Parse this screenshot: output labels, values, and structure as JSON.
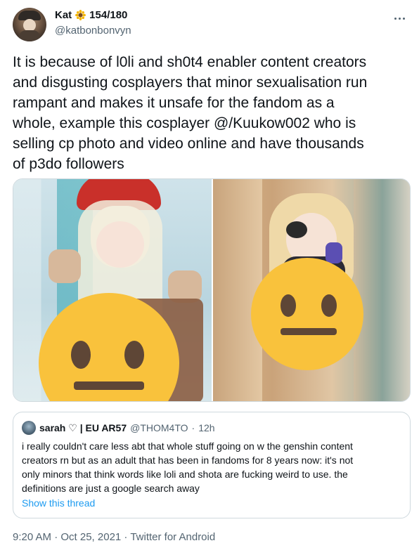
{
  "author": {
    "name": "Kat",
    "count": "154/180",
    "handle": "@katbonbonvyn"
  },
  "tweet": {
    "text": "It is because of l0li and sh0t4 enabler content creators\nand disgusting cosplayers that minor sexualisation run\nrampant and makes it unsafe for the fandom as a\nwhole, example this cosplayer @/Kuukow002 who is\nselling cp photo and video online and have thousands\nof p3do followers"
  },
  "quote": {
    "name": "sarah ♡ | EU AR57",
    "handle": "@THOM4TO",
    "separator": "·",
    "time": "12h",
    "text": "i really couldn't care less abt that whole stuff going on w the genshin content\ncreators rn but as an adult that has been in fandoms for 8 years now: it's not\nonly minors that think words like loli and shota are fucking weird to use. the\ndefinitions are just a google search away",
    "show_thread": "Show this thread"
  },
  "footer": {
    "meta": "9:20 AM · Oct 25, 2021 · Twitter for Android"
  },
  "icons": {
    "author_badge": "sunflower-icon",
    "more": "more-icon",
    "censor": "neutral-face-icon"
  },
  "colors": {
    "text": "#0f1419",
    "secondary": "#536471",
    "link": "#1d9bf0",
    "border": "#cfd9de",
    "emoji": "#f9c23c"
  }
}
